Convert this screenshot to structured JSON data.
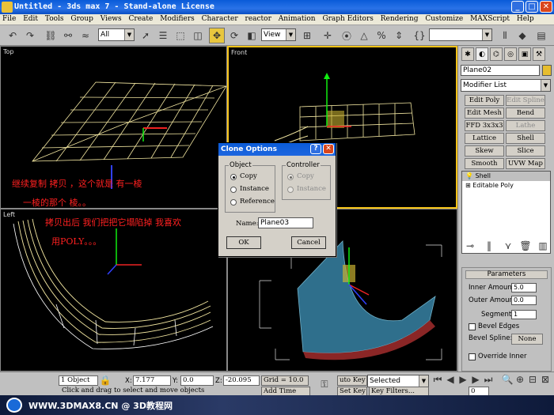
{
  "window": {
    "title": "Untitled  - 3ds max 7  - Stand-alone License",
    "buttons": {
      "minimize": "_",
      "maximize": "□",
      "close": "✕"
    }
  },
  "menu": [
    "File",
    "Edit",
    "Tools",
    "Group",
    "Views",
    "Create",
    "Modifiers",
    "Character",
    "reactor",
    "Animation",
    "Graph Editors",
    "Rendering",
    "Customize",
    "MAXScript",
    "Help"
  ],
  "toolbar": {
    "selection_filter": "All",
    "ref_coord": "View",
    "named_selection": ""
  },
  "viewports": {
    "top_label": "Top",
    "front_label": "Front",
    "left_label": "Left",
    "annotations": [
      "继续复制 拷贝  ，这个就是   有一棱",
      "一棱的那个 棱。。",
      "拷贝出后 我们把把它塌陷掉 我喜欢",
      "用POLY。。。"
    ]
  },
  "dialog": {
    "title": "Clone Options",
    "help_button": "?",
    "close_button": "✕",
    "object_group": "Object",
    "object_options": [
      "Copy",
      "Instance",
      "Reference"
    ],
    "object_selected": "Copy",
    "controller_group": "Controller",
    "controller_options": [
      "Copy",
      "Instance"
    ],
    "name_label": "Name:",
    "name_value": "Plane03",
    "ok_label": "OK",
    "cancel_label": "Cancel"
  },
  "command_panel": {
    "object_name": "Plane02",
    "object_color": "#e6bd2e",
    "modifier_list": "Modifier List",
    "modifier_buttons": [
      "Edit Poly",
      "Edit Spline",
      "Edit Mesh",
      "Bend",
      "FFD 3x3x3",
      "Lathe",
      "Lattice",
      "Shell",
      "Skew",
      "Slice",
      "Smooth",
      "UVW Map"
    ],
    "disabled_buttons": [
      "Edit Spline",
      "Lathe"
    ],
    "stack": [
      "Shell",
      "Editable Poly"
    ],
    "rollout_title": "Parameters",
    "inner_amount_label": "Inner Amount:",
    "inner_amount": "5.0",
    "outer_amount_label": "Outer Amount:",
    "outer_amount": "0.0",
    "segments_label": "Segments:",
    "segments": "1",
    "bevel_edges_label": "Bevel Edges",
    "bevel_spline_label": "Bevel Spline:",
    "bevel_spline_value": "None",
    "override_inner_label": "Override Inner"
  },
  "status": {
    "object_count": "1 Object",
    "x_label": "X:",
    "x_value": "7.177",
    "y_label": "Y:",
    "y_value": "0.0",
    "z_label": "Z:",
    "z_value": "-20.095",
    "grid": "Grid = 10.0",
    "auto_key": "uto Key",
    "set_key": "Set Key",
    "key_mode": "Selected",
    "key_filters": "Key Filters...",
    "prompt": "Click and drag to select and move objects",
    "add_time_tag": "Add Time Tag",
    "frame": "0"
  },
  "watermark": {
    "text": "WWW.3DMAX8.CN @ 3D教程网"
  },
  "colors": {
    "viewport_bg": "#000000",
    "active_border": "#f6c318",
    "wireframe": "#f2e6a0",
    "annotation": "#ff2020",
    "shell_surface": "#2f6f8c"
  }
}
